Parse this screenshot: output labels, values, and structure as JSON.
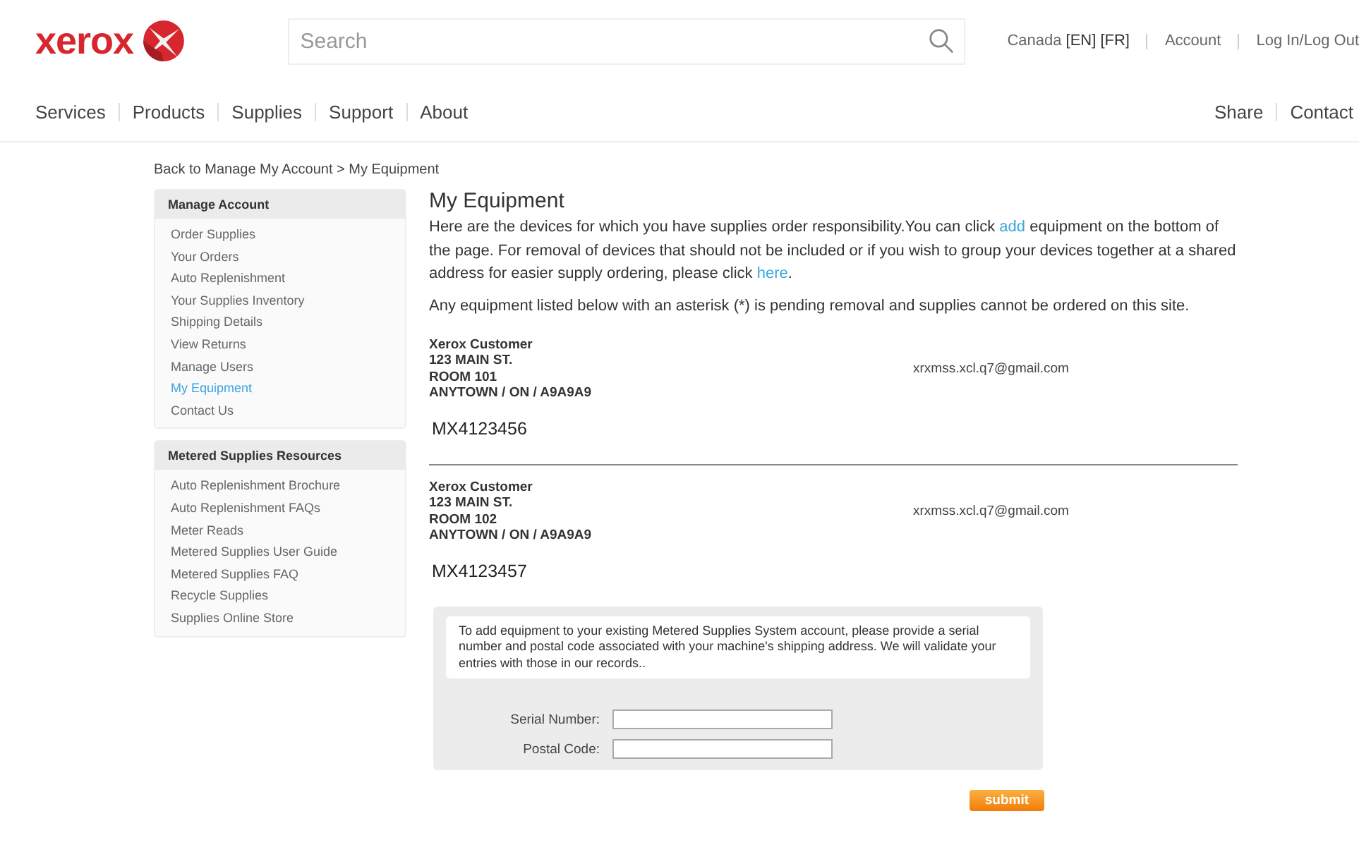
{
  "header": {
    "logo": "xerox",
    "search": {
      "placeholder": "Search"
    },
    "locale": {
      "country": "Canada",
      "languages": [
        "[EN]",
        "[FR]"
      ]
    },
    "links": [
      "Account",
      "Log In/Log Out"
    ]
  },
  "nav": {
    "items": [
      "Services",
      "Products",
      "Supplies",
      "Support",
      "About"
    ],
    "right": [
      "Share",
      "Contact"
    ]
  },
  "breadcrumb": "Back to Manage My Account > My Equipment",
  "sidebar": [
    {
      "title": "Manage Account",
      "items": [
        {
          "label": "Order Supplies",
          "selected": false
        },
        {
          "label": "Your Orders",
          "selected": false
        },
        {
          "label": "Auto Replenishment",
          "selected": false
        },
        {
          "label": "Your Supplies Inventory",
          "selected": false
        },
        {
          "label": "Shipping Details",
          "selected": false
        },
        {
          "label": "View Returns",
          "selected": false
        },
        {
          "label": "Manage Users",
          "selected": false
        },
        {
          "label": "My Equipment",
          "selected": true
        },
        {
          "label": "Contact Us",
          "selected": false
        }
      ]
    },
    {
      "title": "Metered Supplies Resources",
      "items": [
        {
          "label": "Auto Replenishment Brochure",
          "selected": false
        },
        {
          "label": "Auto Replenishment FAQs",
          "selected": false
        },
        {
          "label": "Meter Reads",
          "selected": false
        },
        {
          "label": "Metered Supplies User Guide",
          "selected": false
        },
        {
          "label": "Metered Supplies FAQ",
          "selected": false
        },
        {
          "label": "Recycle Supplies",
          "selected": false
        },
        {
          "label": "Supplies Online Store",
          "selected": false
        }
      ]
    }
  ],
  "main": {
    "title": "My Equipment",
    "intro": [
      {
        "kind": "text",
        "text": "Here are the devices for which you have supplies order responsibility.You can click "
      },
      {
        "kind": "link",
        "text": "add"
      },
      {
        "kind": "text",
        "text": " equipment on the bottom of the page. For removal of devices that should not be included or if you wish to group your devices together at a shared address for easier supply ordering, please click "
      },
      {
        "kind": "link",
        "text": "here"
      },
      {
        "kind": "text",
        "text": "."
      }
    ],
    "note": "Any equipment listed below with an asterisk (*) is pending removal and supplies cannot be ordered on this site.",
    "equipment": [
      {
        "address": [
          "Xerox Customer",
          "123 MAIN ST.",
          "ROOM 101",
          "ANYTOWN / ON / A9A9A9"
        ],
        "email": "xrxmss.xcl.q7@gmail.com",
        "serial": "MX4123456"
      },
      {
        "address": [
          "Xerox Customer",
          "123 MAIN ST.",
          "ROOM 102",
          "ANYTOWN / ON / A9A9A9"
        ],
        "email": "xrxmss.xcl.q7@gmail.com",
        "serial": "MX4123457"
      }
    ],
    "add_form": {
      "info": "To add equipment to your existing Metered Supplies System account, please provide a serial number and postal code associated with your machine's shipping address. We will validate your entries with those in our records..",
      "fields": [
        {
          "label": "Serial Number:"
        },
        {
          "label": "Postal Code:"
        }
      ],
      "submit": "submit"
    }
  }
}
